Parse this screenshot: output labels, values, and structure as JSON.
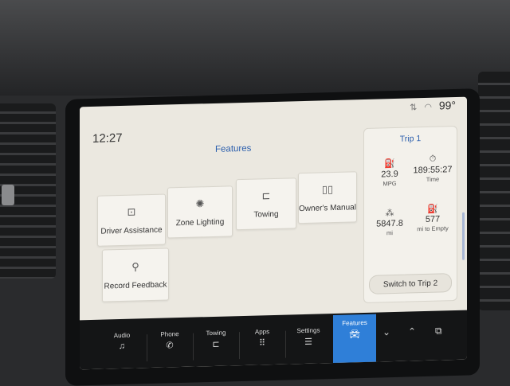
{
  "status": {
    "icons": [
      "signal-icon",
      "wifi-icon"
    ],
    "temperature": "99°"
  },
  "clock": "12:27",
  "features_panel": {
    "title": "Features",
    "tiles": [
      {
        "label": "Driver Assistance",
        "icon": "driver-assist-icon"
      },
      {
        "label": "Zone Lighting",
        "icon": "zone-lighting-icon"
      },
      {
        "label": "Towing",
        "icon": "trailer-icon"
      },
      {
        "label": "Owner's Manual",
        "icon": "book-icon"
      },
      {
        "label": "Record Feedback",
        "icon": "microphone-icon"
      }
    ]
  },
  "trip": {
    "title": "Trip 1",
    "stats": [
      {
        "value": "23.9",
        "label": "MPG",
        "icon": "fuel-icon"
      },
      {
        "value": "189:55:27",
        "label": "Time",
        "icon": "stopwatch-icon"
      },
      {
        "value": "5847.8",
        "label": "mi",
        "icon": "road-icon"
      },
      {
        "value": "577",
        "label": "mi to Empty",
        "icon": "fuel-pump-icon"
      }
    ],
    "switch_label": "Switch to Trip 2"
  },
  "dock": {
    "items": [
      {
        "label": "Audio",
        "icon": "music-note-icon"
      },
      {
        "label": "Phone",
        "icon": "phone-icon"
      },
      {
        "label": "Towing",
        "icon": "trailer-icon"
      },
      {
        "label": "Apps",
        "icon": "grid-icon"
      },
      {
        "label": "Settings",
        "icon": "sliders-icon"
      },
      {
        "label": "Features",
        "icon": "car-icon",
        "active": true
      }
    ]
  },
  "colors": {
    "accent": "#2f7fd8",
    "title_blue": "#2c5fad",
    "screen_bg": "#ebe8e0"
  }
}
